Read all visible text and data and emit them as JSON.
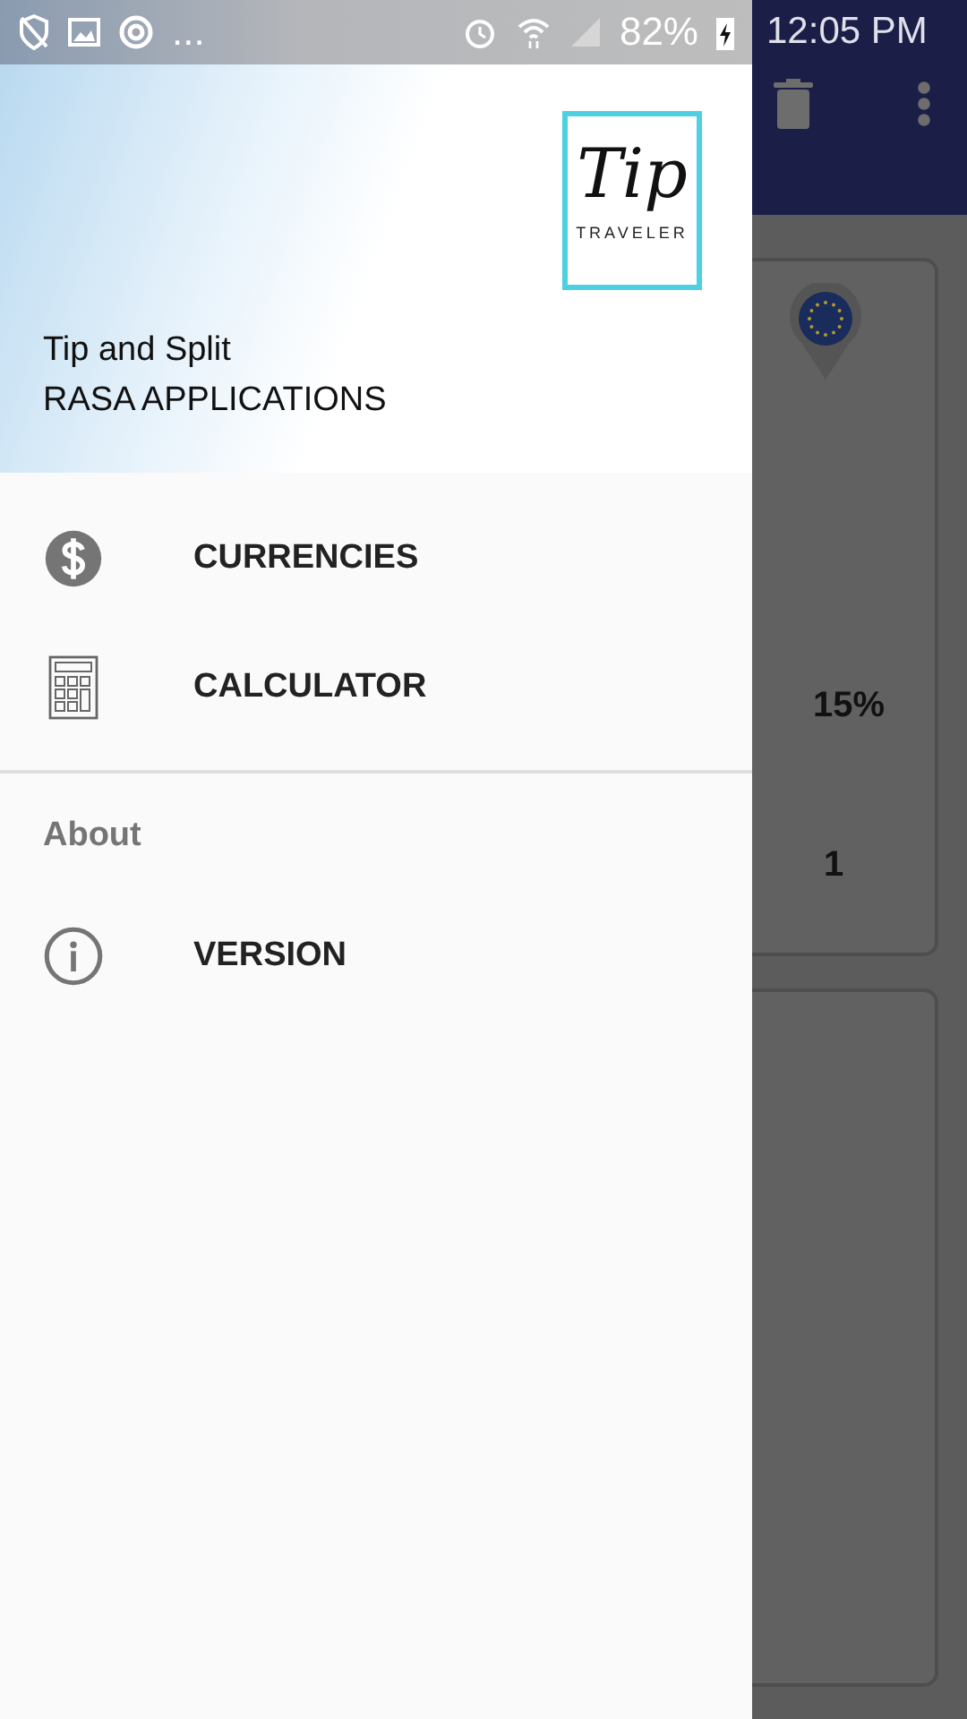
{
  "status_bar": {
    "more": "...",
    "battery": "82%",
    "time": "12:05 PM"
  },
  "drawer": {
    "logo": {
      "script": "Tip",
      "caption": "TRAVELER"
    },
    "title": "Tip and Split",
    "subtitle": "RASA APPLICATIONS",
    "sections": [
      {
        "items": [
          {
            "kind": "currency",
            "label": "CURRENCIES"
          },
          {
            "kind": "calculator",
            "label": "CALCULATOR"
          }
        ]
      },
      {
        "heading": "About",
        "items": [
          {
            "kind": "info",
            "label": "VERSION"
          }
        ]
      }
    ]
  },
  "background": {
    "tip_percent": "15%",
    "people": "1"
  }
}
